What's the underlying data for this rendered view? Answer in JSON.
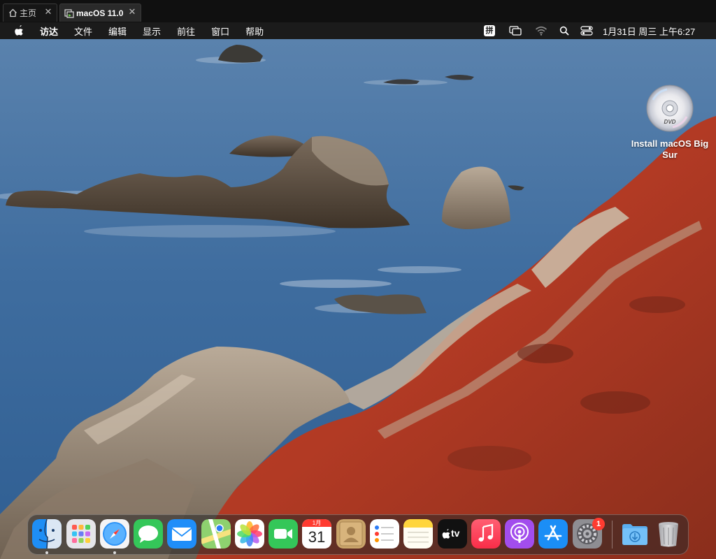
{
  "tabs": [
    {
      "label": "主页",
      "icon": "home-icon"
    },
    {
      "label": "macOS 11.0",
      "icon": "vm-icon"
    }
  ],
  "menubar": {
    "menus": [
      "访达",
      "文件",
      "编辑",
      "显示",
      "前往",
      "窗口",
      "帮助"
    ],
    "input_method": "拼",
    "clock": "1月31日 周三 上午6:27"
  },
  "desktop": {
    "icon_label": "Install macOS Big Sur",
    "dvd_text": "DVD"
  },
  "dock": {
    "calendar_month": "1月",
    "calendar_day": "31",
    "tv_label": "tv",
    "settings_badge": "1",
    "apps": [
      "finder",
      "launchpad",
      "safari",
      "messages",
      "mail",
      "maps",
      "photos",
      "facetime",
      "calendar",
      "contacts",
      "reminders",
      "notes",
      "apple-tv",
      "music",
      "podcasts",
      "app-store",
      "system-preferences",
      "downloads",
      "trash"
    ]
  }
}
